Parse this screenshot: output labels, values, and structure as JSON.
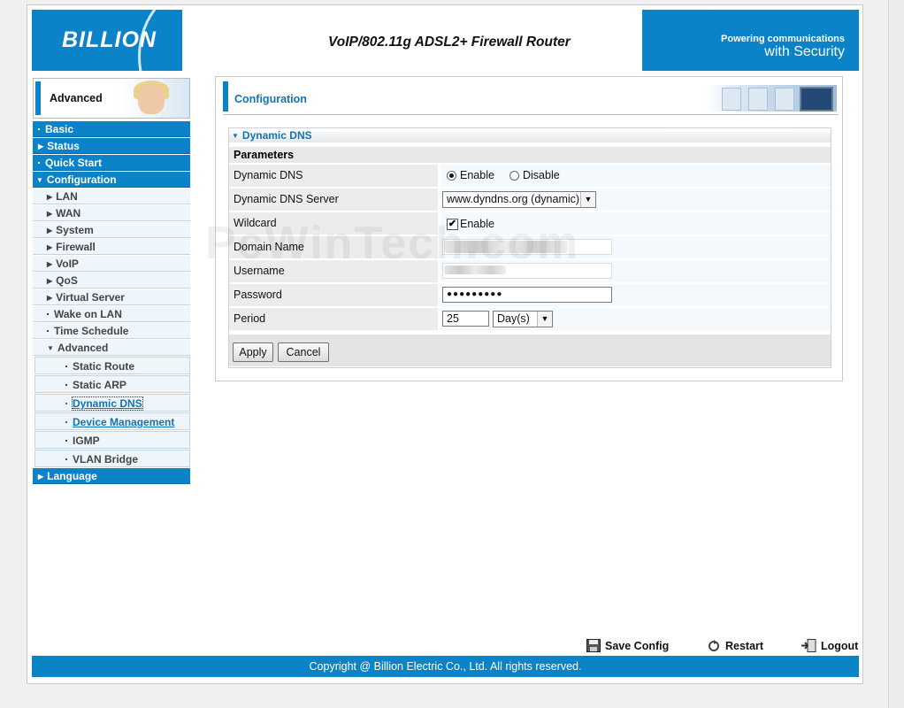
{
  "header": {
    "logo": "BILLION",
    "product_title": "VoIP/802.11g ADSL2+ Firewall Router",
    "tagline_line1": "Powering communications",
    "tagline_line2": "with Security"
  },
  "sidebar": {
    "mode_label": "Advanced",
    "items": [
      {
        "label": "Basic"
      },
      {
        "label": "Status"
      },
      {
        "label": "Quick Start"
      },
      {
        "label": "Configuration"
      },
      {
        "label": "LAN"
      },
      {
        "label": "WAN"
      },
      {
        "label": "System"
      },
      {
        "label": "Firewall"
      },
      {
        "label": "VoIP"
      },
      {
        "label": "QoS"
      },
      {
        "label": "Virtual Server"
      },
      {
        "label": "Wake on LAN"
      },
      {
        "label": "Time Schedule"
      },
      {
        "label": "Advanced"
      },
      {
        "label": "Static Route"
      },
      {
        "label": "Static ARP"
      },
      {
        "label": "Dynamic DNS"
      },
      {
        "label": "Device Management"
      },
      {
        "label": "IGMP"
      },
      {
        "label": "VLAN Bridge"
      },
      {
        "label": "Language"
      }
    ]
  },
  "main": {
    "title": "Configuration",
    "panel_title": "Dynamic DNS",
    "params_header": "Parameters",
    "fields": {
      "dynamic_dns": {
        "label": "Dynamic DNS",
        "option_enable": "Enable",
        "option_disable": "Disable",
        "selected": "Enable"
      },
      "server": {
        "label": "Dynamic DNS Server",
        "value": "www.dyndns.org (dynamic)"
      },
      "wildcard": {
        "label": "Wildcard",
        "option": "Enable",
        "checked": true,
        "check_glyph": "✔"
      },
      "domain": {
        "label": "Domain Name"
      },
      "username": {
        "label": "Username"
      },
      "password": {
        "label": "Password",
        "value": "●●●●●●●●●"
      },
      "period": {
        "label": "Period",
        "value": "25",
        "unit": "Day(s)"
      }
    },
    "buttons": {
      "apply": "Apply",
      "cancel": "Cancel"
    }
  },
  "watermark": "PcWinTech.com",
  "footer": {
    "save": "Save Config",
    "restart": "Restart",
    "logout": "Logout",
    "copyright": "Copyright @ Billion Electric Co., Ltd. All rights reserved."
  },
  "colors": {
    "accent": "#0a83c9",
    "link": "#1174b8"
  }
}
